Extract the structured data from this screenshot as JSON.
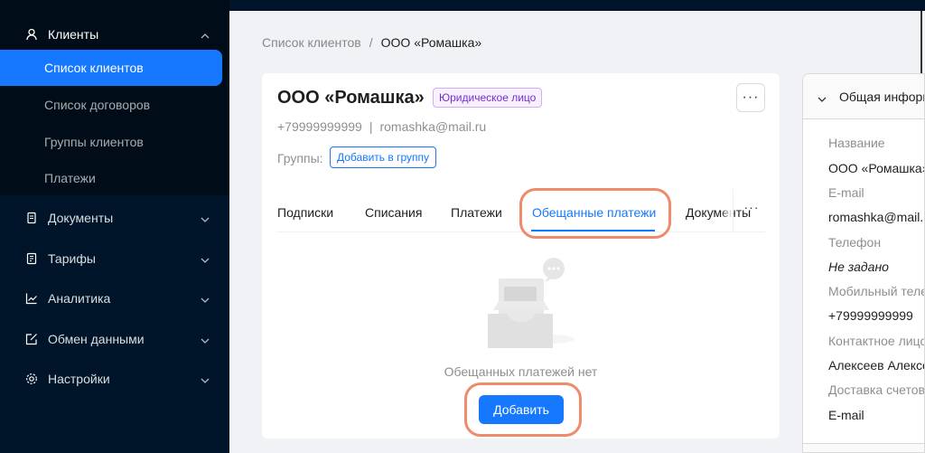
{
  "sidebar": {
    "clients_label": "Клиенты",
    "sub_items": [
      "Список клиентов",
      "Список договоров",
      "Группы клиентов",
      "Платежи"
    ],
    "groups": [
      "Документы",
      "Тарифы",
      "Аналитика",
      "Обмен данными",
      "Настройки"
    ]
  },
  "breadcrumb": {
    "parent": "Список клиентов",
    "separator": "/",
    "current": "ООО «Ромашка»"
  },
  "client": {
    "name": "ООО «Ромашка»",
    "type_tag": "Юридическое лицо",
    "phone": "+79999999999",
    "divider": "|",
    "email": "romashka@mail.ru",
    "groups_label": "Группы:",
    "add_group_label": "Добавить в группу",
    "more_label": "···"
  },
  "tabs": {
    "items": [
      "Подписки",
      "Списания",
      "Платежи",
      "Обещанные платежи",
      "Документы"
    ],
    "more_label": "···"
  },
  "empty": {
    "text": "Обещанных платежей нет",
    "add_label": "Добавить"
  },
  "info_panel": {
    "title": "Общая информация",
    "fields": [
      {
        "label": "Название",
        "value": "ООО «Ромашка»"
      },
      {
        "label": "E-mail",
        "value": "romashka@mail.ru"
      },
      {
        "label": "Телефон",
        "value": "Не задано"
      },
      {
        "label": "Мобильный телефон",
        "value": "+79999999999"
      },
      {
        "label": "Контактное лицо",
        "value": "Алексеев Алексей"
      },
      {
        "label": "Доставка счетов",
        "value": "E-mail"
      }
    ]
  },
  "colors": {
    "accent": "#1677ff",
    "sidebar": "#001529",
    "highlight": "#ef8a6b",
    "tag": "#722ed1"
  }
}
